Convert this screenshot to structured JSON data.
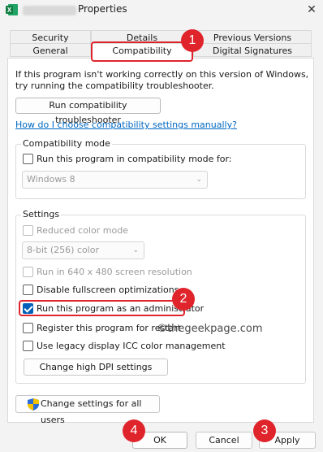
{
  "window": {
    "title": "Properties",
    "close_glyph": "✕",
    "app_icon": "excel-icon"
  },
  "tabs": {
    "row1": [
      "Security",
      "Details",
      "Previous Versions"
    ],
    "row2": [
      "General",
      "Compatibility",
      "Digital Signatures"
    ],
    "active": "Compatibility"
  },
  "intro_text": {
    "line1": "If this program isn't working correctly on this version of Windows,",
    "line2": "try running the compatibility troubleshooter."
  },
  "buttons": {
    "troubleshooter": "Run compatibility troubleshooter",
    "change_dpi": "Change high DPI settings",
    "change_all_users": "Change settings for all users",
    "ok": "OK",
    "cancel": "Cancel",
    "apply": "Apply"
  },
  "link": "How do I choose compatibility settings manually?",
  "compat_mode": {
    "label": "Compatibility mode",
    "checkbox": "Run this program in compatibility mode for:",
    "checked": false,
    "selected_os": "Windows 8"
  },
  "settings": {
    "label": "Settings",
    "reduced_color": "Reduced color mode",
    "color_value": "8-bit (256) color",
    "run_640": "Run in 640 x 480 screen resolution",
    "disable_fullscreen": "Disable fullscreen optimizations",
    "run_admin": "Run this program as an administrator",
    "run_admin_checked": true,
    "register_restart": "Register this program for restart",
    "legacy_icc": "Use legacy display ICC color management"
  },
  "watermark": "©thegeekpage.com",
  "callouts": [
    "1",
    "2",
    "3",
    "4"
  ],
  "colors": {
    "callout": "#e0242c",
    "link": "#0067c0",
    "checkbox_checked": "#005fb8"
  }
}
